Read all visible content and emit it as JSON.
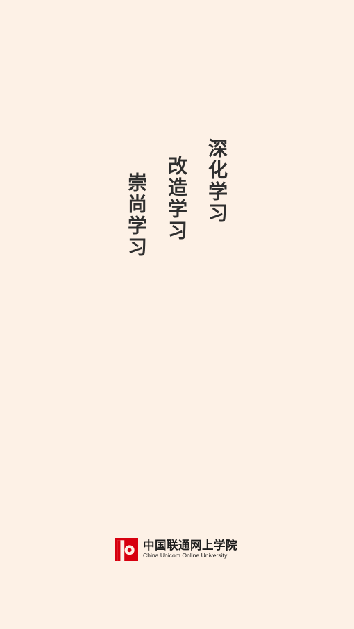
{
  "slogans": {
    "first": "深化学习",
    "second": "改造学习",
    "third": "崇尚学习"
  },
  "brand": {
    "name_cn": "中国联通网上学院",
    "name_en": "China Unicom Online University",
    "logo_icon": "china-unicom-logo-icon",
    "logo_color": "#d7000f"
  },
  "colors": {
    "background": "#fdf1e6",
    "text": "#2f2f2f"
  }
}
